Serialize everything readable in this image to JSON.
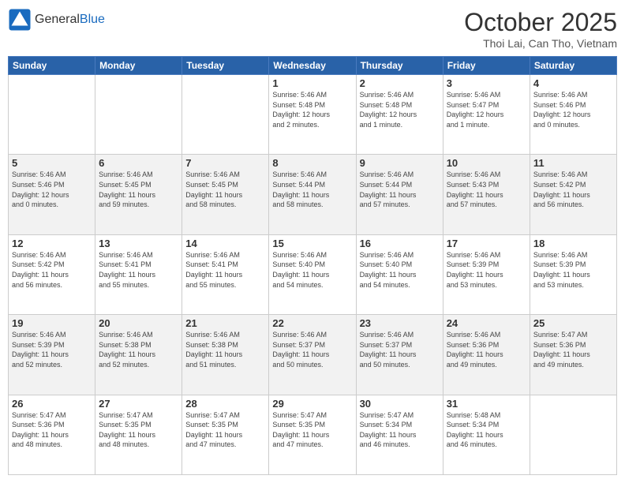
{
  "header": {
    "logo_general": "General",
    "logo_blue": "Blue",
    "title": "October 2025",
    "subtitle": "Thoi Lai, Can Tho, Vietnam"
  },
  "days_of_week": [
    "Sunday",
    "Monday",
    "Tuesday",
    "Wednesday",
    "Thursday",
    "Friday",
    "Saturday"
  ],
  "weeks": [
    [
      {
        "day": "",
        "info": ""
      },
      {
        "day": "",
        "info": ""
      },
      {
        "day": "",
        "info": ""
      },
      {
        "day": "1",
        "info": "Sunrise: 5:46 AM\nSunset: 5:48 PM\nDaylight: 12 hours\nand 2 minutes."
      },
      {
        "day": "2",
        "info": "Sunrise: 5:46 AM\nSunset: 5:48 PM\nDaylight: 12 hours\nand 1 minute."
      },
      {
        "day": "3",
        "info": "Sunrise: 5:46 AM\nSunset: 5:47 PM\nDaylight: 12 hours\nand 1 minute."
      },
      {
        "day": "4",
        "info": "Sunrise: 5:46 AM\nSunset: 5:46 PM\nDaylight: 12 hours\nand 0 minutes."
      }
    ],
    [
      {
        "day": "5",
        "info": "Sunrise: 5:46 AM\nSunset: 5:46 PM\nDaylight: 12 hours\nand 0 minutes."
      },
      {
        "day": "6",
        "info": "Sunrise: 5:46 AM\nSunset: 5:45 PM\nDaylight: 11 hours\nand 59 minutes."
      },
      {
        "day": "7",
        "info": "Sunrise: 5:46 AM\nSunset: 5:45 PM\nDaylight: 11 hours\nand 58 minutes."
      },
      {
        "day": "8",
        "info": "Sunrise: 5:46 AM\nSunset: 5:44 PM\nDaylight: 11 hours\nand 58 minutes."
      },
      {
        "day": "9",
        "info": "Sunrise: 5:46 AM\nSunset: 5:44 PM\nDaylight: 11 hours\nand 57 minutes."
      },
      {
        "day": "10",
        "info": "Sunrise: 5:46 AM\nSunset: 5:43 PM\nDaylight: 11 hours\nand 57 minutes."
      },
      {
        "day": "11",
        "info": "Sunrise: 5:46 AM\nSunset: 5:42 PM\nDaylight: 11 hours\nand 56 minutes."
      }
    ],
    [
      {
        "day": "12",
        "info": "Sunrise: 5:46 AM\nSunset: 5:42 PM\nDaylight: 11 hours\nand 56 minutes."
      },
      {
        "day": "13",
        "info": "Sunrise: 5:46 AM\nSunset: 5:41 PM\nDaylight: 11 hours\nand 55 minutes."
      },
      {
        "day": "14",
        "info": "Sunrise: 5:46 AM\nSunset: 5:41 PM\nDaylight: 11 hours\nand 55 minutes."
      },
      {
        "day": "15",
        "info": "Sunrise: 5:46 AM\nSunset: 5:40 PM\nDaylight: 11 hours\nand 54 minutes."
      },
      {
        "day": "16",
        "info": "Sunrise: 5:46 AM\nSunset: 5:40 PM\nDaylight: 11 hours\nand 54 minutes."
      },
      {
        "day": "17",
        "info": "Sunrise: 5:46 AM\nSunset: 5:39 PM\nDaylight: 11 hours\nand 53 minutes."
      },
      {
        "day": "18",
        "info": "Sunrise: 5:46 AM\nSunset: 5:39 PM\nDaylight: 11 hours\nand 53 minutes."
      }
    ],
    [
      {
        "day": "19",
        "info": "Sunrise: 5:46 AM\nSunset: 5:39 PM\nDaylight: 11 hours\nand 52 minutes."
      },
      {
        "day": "20",
        "info": "Sunrise: 5:46 AM\nSunset: 5:38 PM\nDaylight: 11 hours\nand 52 minutes."
      },
      {
        "day": "21",
        "info": "Sunrise: 5:46 AM\nSunset: 5:38 PM\nDaylight: 11 hours\nand 51 minutes."
      },
      {
        "day": "22",
        "info": "Sunrise: 5:46 AM\nSunset: 5:37 PM\nDaylight: 11 hours\nand 50 minutes."
      },
      {
        "day": "23",
        "info": "Sunrise: 5:46 AM\nSunset: 5:37 PM\nDaylight: 11 hours\nand 50 minutes."
      },
      {
        "day": "24",
        "info": "Sunrise: 5:46 AM\nSunset: 5:36 PM\nDaylight: 11 hours\nand 49 minutes."
      },
      {
        "day": "25",
        "info": "Sunrise: 5:47 AM\nSunset: 5:36 PM\nDaylight: 11 hours\nand 49 minutes."
      }
    ],
    [
      {
        "day": "26",
        "info": "Sunrise: 5:47 AM\nSunset: 5:36 PM\nDaylight: 11 hours\nand 48 minutes."
      },
      {
        "day": "27",
        "info": "Sunrise: 5:47 AM\nSunset: 5:35 PM\nDaylight: 11 hours\nand 48 minutes."
      },
      {
        "day": "28",
        "info": "Sunrise: 5:47 AM\nSunset: 5:35 PM\nDaylight: 11 hours\nand 47 minutes."
      },
      {
        "day": "29",
        "info": "Sunrise: 5:47 AM\nSunset: 5:35 PM\nDaylight: 11 hours\nand 47 minutes."
      },
      {
        "day": "30",
        "info": "Sunrise: 5:47 AM\nSunset: 5:34 PM\nDaylight: 11 hours\nand 46 minutes."
      },
      {
        "day": "31",
        "info": "Sunrise: 5:48 AM\nSunset: 5:34 PM\nDaylight: 11 hours\nand 46 minutes."
      },
      {
        "day": "",
        "info": ""
      }
    ]
  ]
}
